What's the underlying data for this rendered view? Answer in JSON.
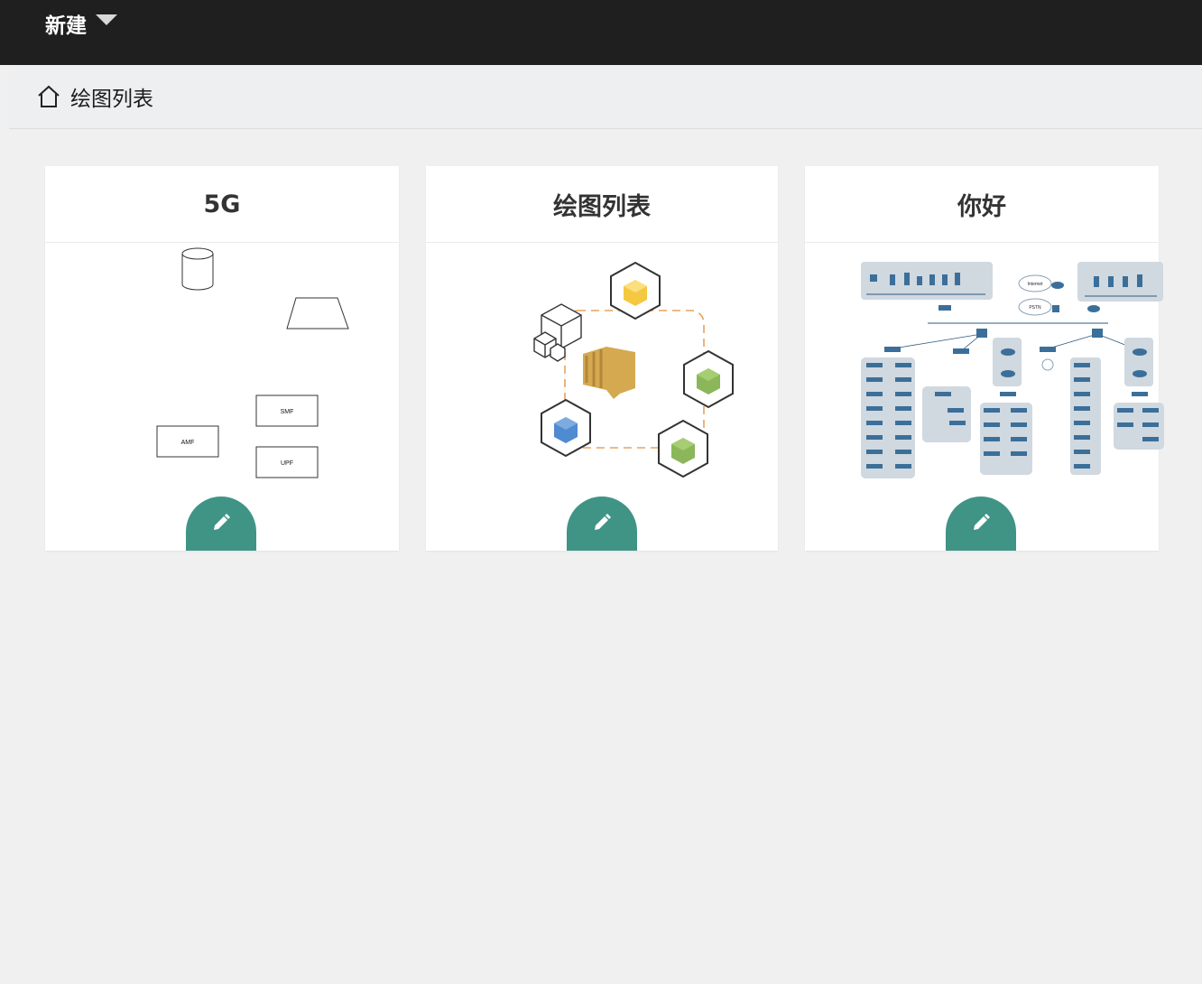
{
  "topbar": {
    "new_label": "新建"
  },
  "breadcrumb": {
    "title": "绘图列表"
  },
  "cards": [
    {
      "title": "5G",
      "preview": {
        "labels": [
          "SMF",
          "AMF",
          "UPF"
        ]
      }
    },
    {
      "title": "绘图列表"
    },
    {
      "title": "你好",
      "preview": {
        "labels": [
          "Internet",
          "PSTN"
        ]
      }
    }
  ],
  "colors": {
    "topbar": "#1f1f1f",
    "edit_button": "#3f9486",
    "background": "#f0f0f0"
  },
  "icons": {
    "home": "home-icon",
    "caret": "caret-down-icon",
    "edit": "pencil-icon"
  }
}
